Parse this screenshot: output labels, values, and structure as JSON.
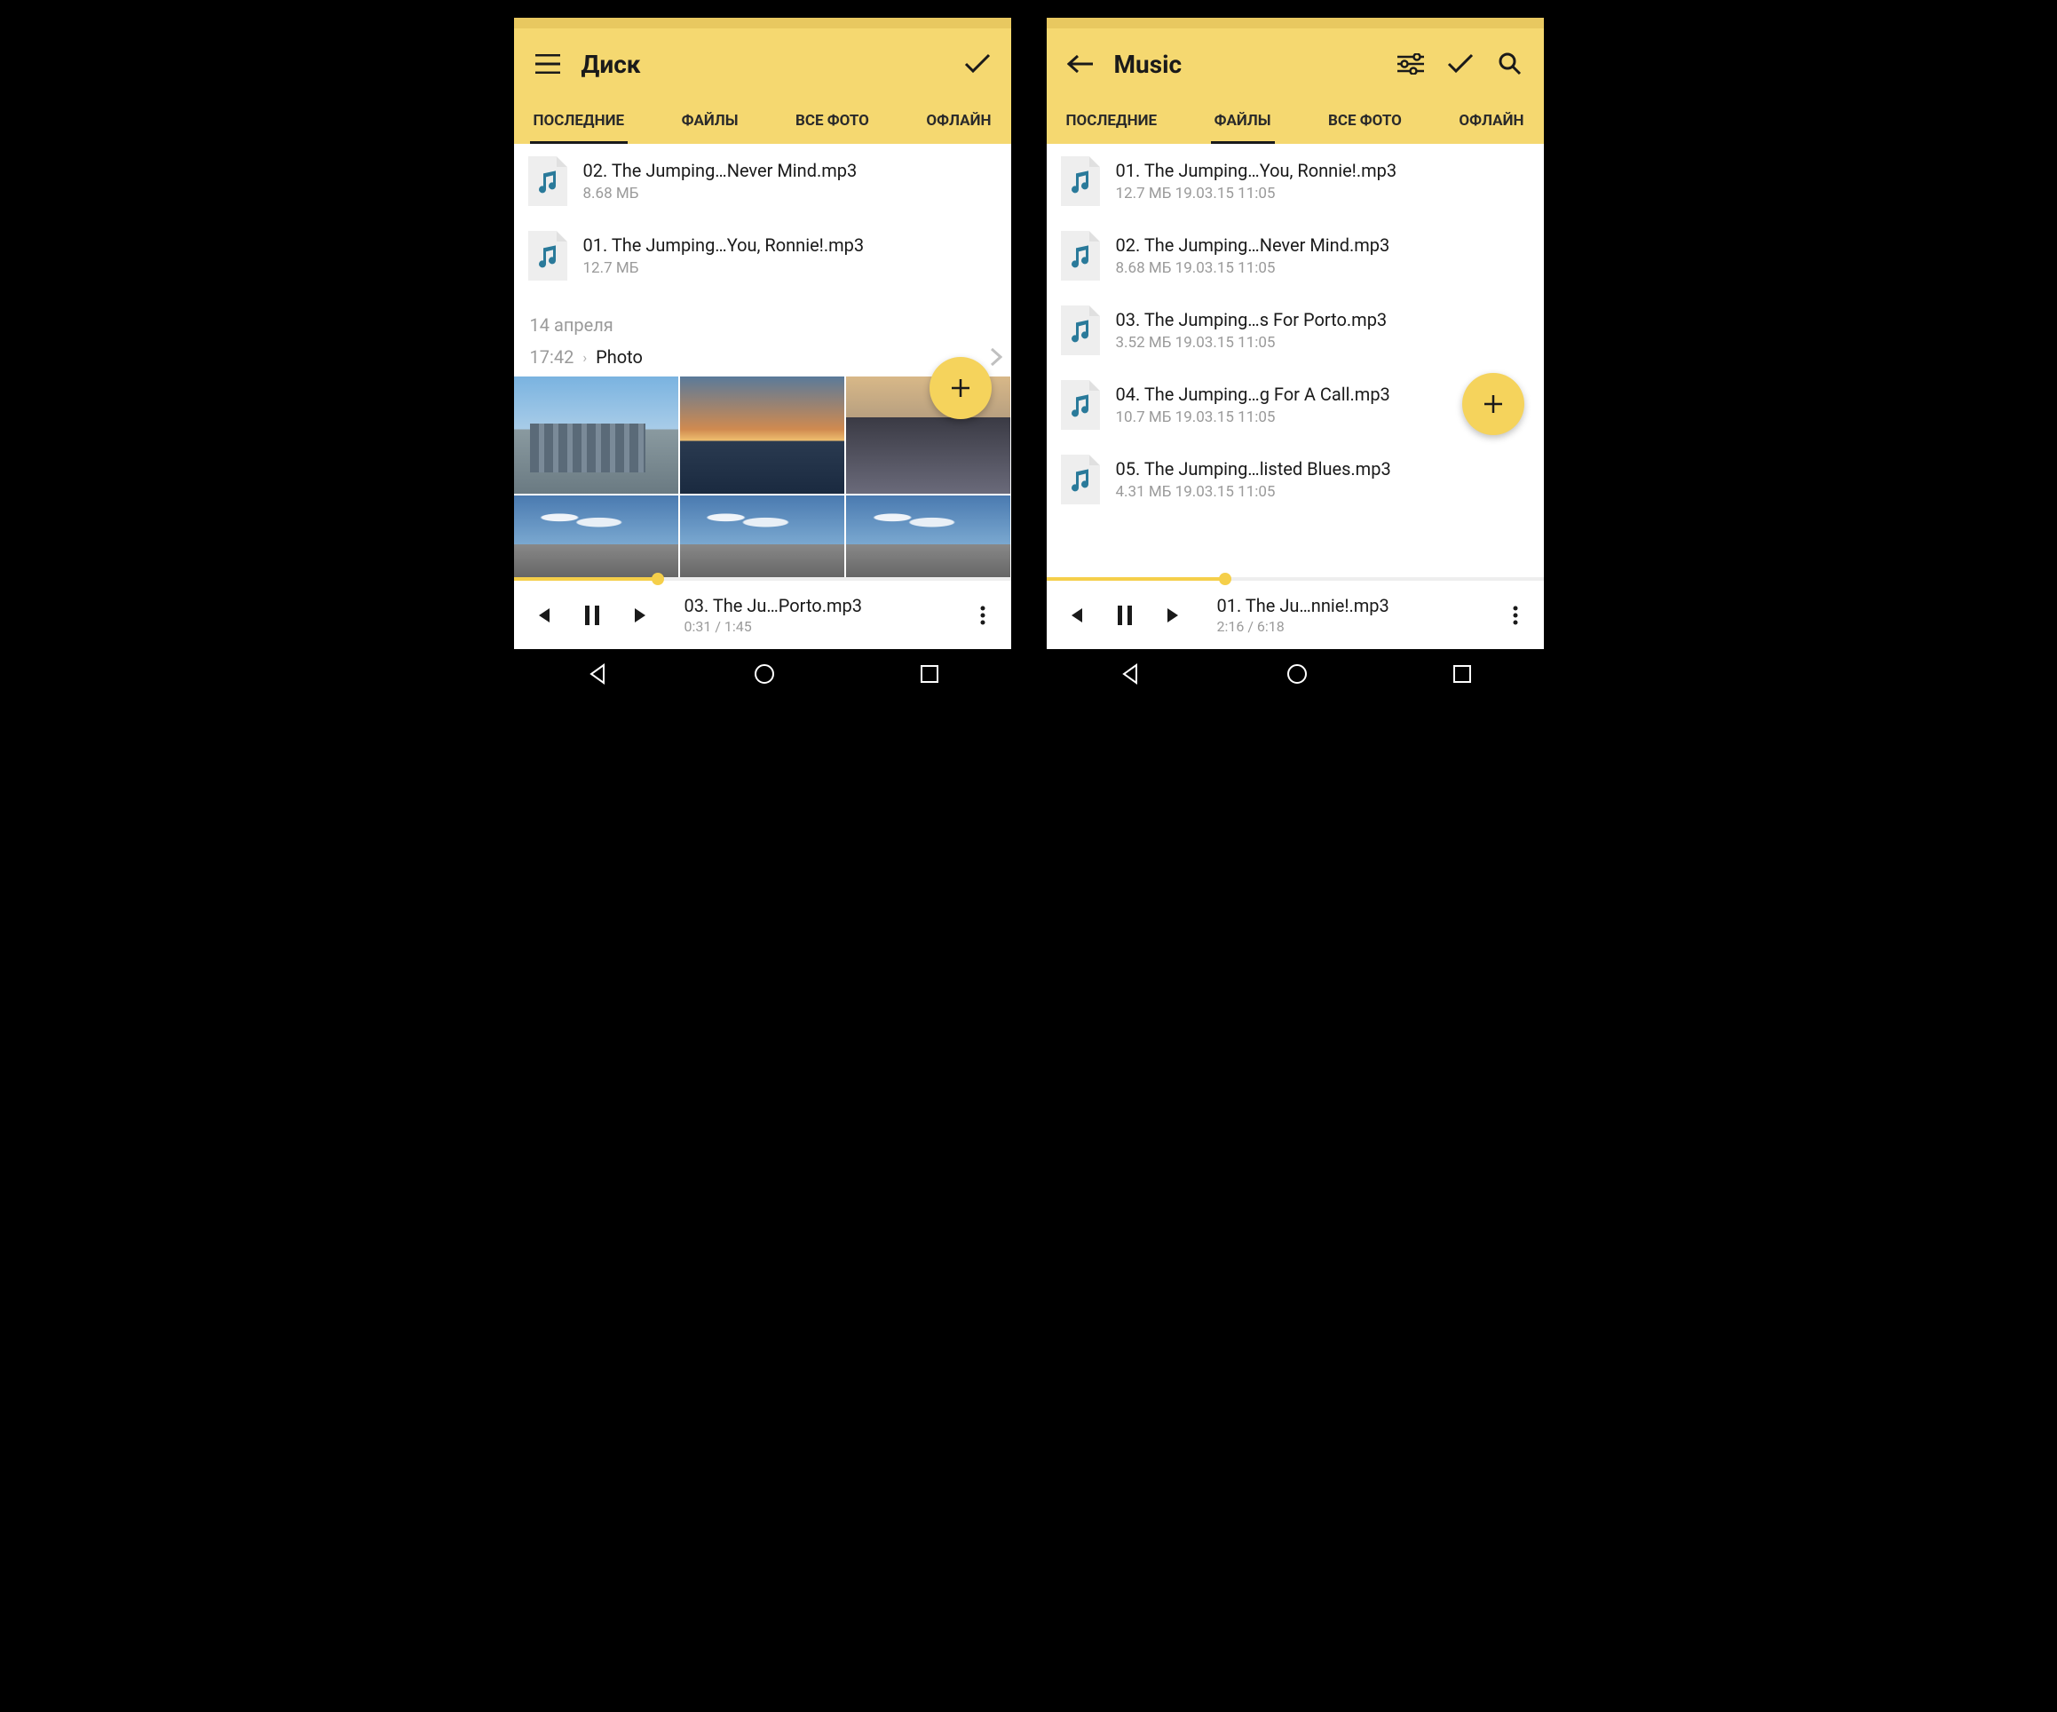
{
  "phoneA": {
    "title": "Диск",
    "tabs": [
      "ПОСЛЕДНИЕ",
      "ФАЙЛЫ",
      "ВСЕ ФОТО",
      "ОФЛАЙН"
    ],
    "activeTab": 0,
    "files": [
      {
        "name": "02. The Jumping…Never Mind.mp3",
        "meta": "8.68 МБ"
      },
      {
        "name": "01. The Jumping…You, Ronnie!.mp3",
        "meta": "12.7 МБ"
      }
    ],
    "dateHeader": "14 апреля",
    "photoTime": "17:42",
    "photoLabel": "Photo",
    "player": {
      "title": "03. The Ju…Porto.mp3",
      "time": "0:31 / 1:45",
      "progressPct": 29
    }
  },
  "phoneB": {
    "title": "Music",
    "tabs": [
      "ПОСЛЕДНИЕ",
      "ФАЙЛЫ",
      "ВСЕ ФОТО",
      "ОФЛАЙН"
    ],
    "activeTab": 1,
    "files": [
      {
        "name": "01. The Jumping…You, Ronnie!.mp3",
        "meta": "12.7 МБ 19.03.15 11:05"
      },
      {
        "name": "02. The Jumping…Never Mind.mp3",
        "meta": "8.68 МБ 19.03.15 11:05"
      },
      {
        "name": "03. The Jumping…s For Porto.mp3",
        "meta": "3.52 МБ 19.03.15 11:05"
      },
      {
        "name": "04. The Jumping…g For A Call.mp3",
        "meta": "10.7 МБ 19.03.15 11:05"
      },
      {
        "name": "05. The Jumping…listed Blues.mp3",
        "meta": "4.31 МБ 19.03.15 11:05"
      }
    ],
    "player": {
      "title": "01. The Ju…nnie!.mp3",
      "time": "2:16 / 6:18",
      "progressPct": 36
    }
  }
}
